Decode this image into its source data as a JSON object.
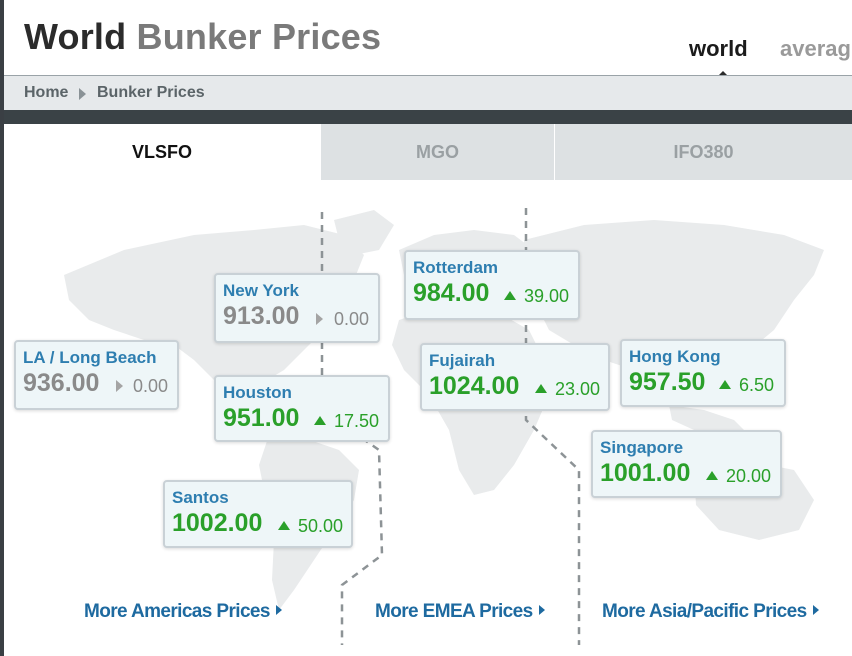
{
  "header": {
    "title_part1": "World",
    "title_part2": "Bunker Prices",
    "nav": [
      "world",
      "averag"
    ]
  },
  "breadcrumb": {
    "home": "Home",
    "current": "Bunker Prices"
  },
  "fuel_tabs": [
    "VLSFO",
    "MGO",
    "IFO380"
  ],
  "ports": [
    {
      "name": "LA / Long Beach",
      "price": "936.00",
      "change": "0.00",
      "direction": "flat"
    },
    {
      "name": "New York",
      "price": "913.00",
      "change": "0.00",
      "direction": "flat"
    },
    {
      "name": "Houston",
      "price": "951.00",
      "change": "17.50",
      "direction": "up"
    },
    {
      "name": "Santos",
      "price": "1002.00",
      "change": "50.00",
      "direction": "up"
    },
    {
      "name": "Rotterdam",
      "price": "984.00",
      "change": "39.00",
      "direction": "up"
    },
    {
      "name": "Fujairah",
      "price": "1024.00",
      "change": "23.00",
      "direction": "up"
    },
    {
      "name": "Hong Kong",
      "price": "957.50",
      "change": "6.50",
      "direction": "up"
    },
    {
      "name": "Singapore",
      "price": "1001.00",
      "change": "20.00",
      "direction": "up"
    }
  ],
  "region_links": {
    "americas": "More Americas Prices",
    "emea": "More EMEA Prices",
    "asia": "More Asia/Pacific Prices"
  },
  "colors": {
    "up": "#2aa02a",
    "flat": "#8a8a8a",
    "port_name": "#2e7eb0",
    "link": "#1e6aa0"
  }
}
